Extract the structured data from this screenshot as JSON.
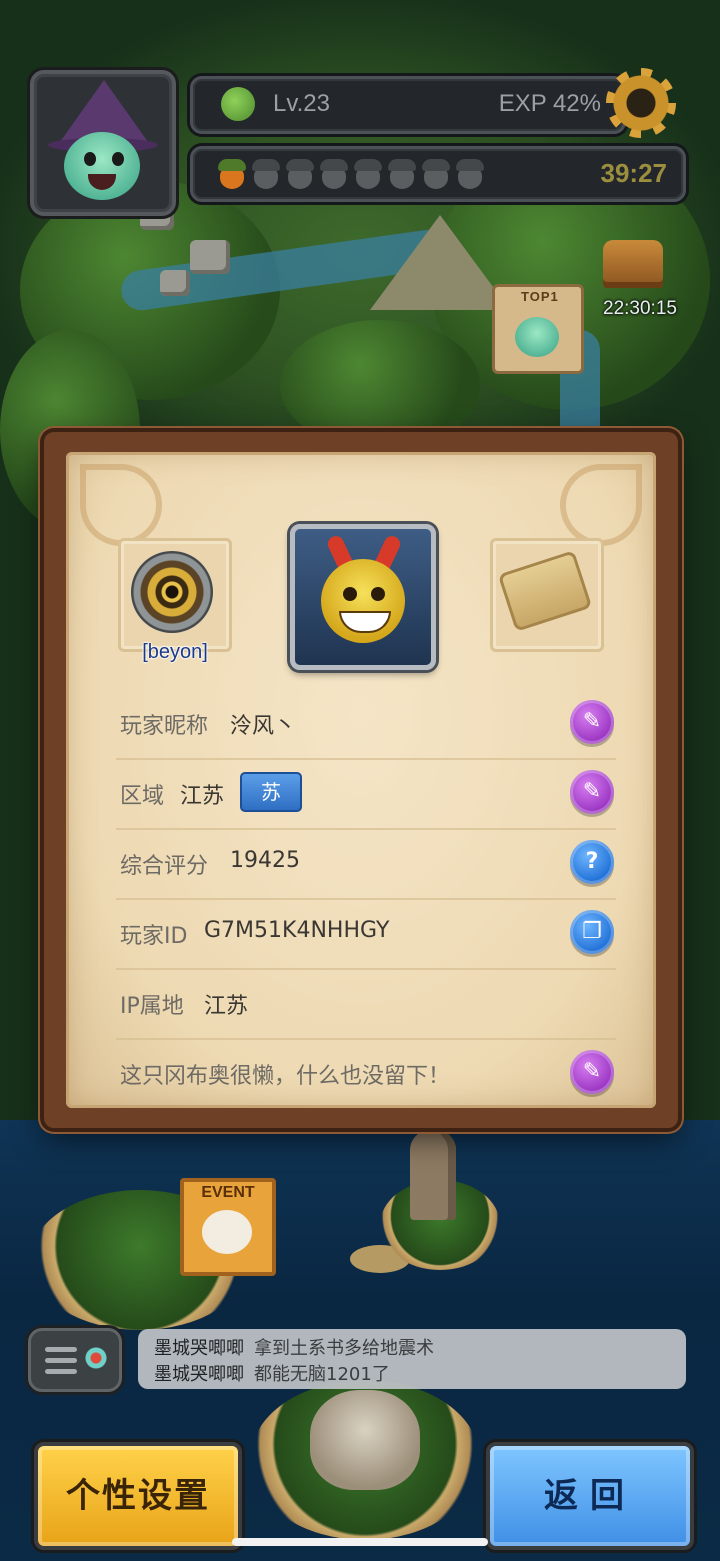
{
  "hud": {
    "level": "Lv.23",
    "exp": "EXP 42%",
    "stamina_timer": "39:27",
    "acorns_full": 1,
    "acorns_total": 8
  },
  "map": {
    "chest_timer": "22:30:15",
    "top_badge": "TOP1",
    "event_sign": "EVENT"
  },
  "profile": {
    "badge_caption": "[beyon]",
    "rows": {
      "nickname": {
        "label": "玩家昵称",
        "value": "泠风丶"
      },
      "region": {
        "label": "区域",
        "value": "江苏",
        "tag": "苏"
      },
      "score": {
        "label": "综合评分",
        "value": "19425",
        "button": "?"
      },
      "player_id": {
        "label": "玩家ID",
        "value": "G7M51K4NHHGY"
      },
      "ip": {
        "label": "IP属地",
        "value": "江苏"
      },
      "bio": {
        "label": "这只冈布奥很懒，什么也没留下！"
      }
    }
  },
  "chat": {
    "messages": [
      {
        "user": "墨城哭唧唧",
        "text": "拿到土系书多给地震术"
      },
      {
        "user": "墨城哭唧唧",
        "text": "都能无脑1201了"
      }
    ]
  },
  "buttons": {
    "personalize": "个性设置",
    "back": "返回"
  },
  "colors": {
    "accent_yellow": "#e8a318",
    "accent_blue": "#3f8fe6",
    "edit_purple": "#9a34c2",
    "info_blue": "#1f6fd6",
    "panel_paper": "#edd9b2"
  }
}
